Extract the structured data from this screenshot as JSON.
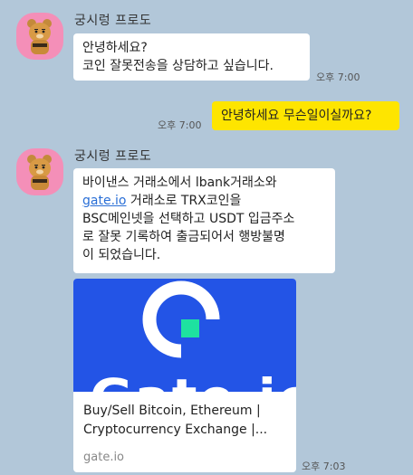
{
  "sender": {
    "name": "궁시렁 프로도"
  },
  "messages": [
    {
      "text": "안녕하세요?\n코인 잘못전송을 상담하고 싶습니다.",
      "time": "오후 7:00"
    },
    {
      "text": "안녕하세요 무슨일이실까요?",
      "time": "오후 7:00"
    },
    {
      "before": "바이낸스 거래소에서 lbank거래소와\n",
      "link": "gate.io",
      "after": " 거래소로 TRX코인을\nBSC메인넷을 선택하고 USDT 입금주소\n로 잘못 기록하여 출금되어서 행방불명\n이 되었습니다."
    },
    {
      "card_title": "Buy/Sell Bitcoin, Ethereum | Cryptocurrency Exchange |...",
      "card_domain": "gate.io",
      "card_brand": "Gate.io",
      "time": "오후 7:03"
    }
  ],
  "colors": {
    "background": "#b2c7d9",
    "my_bubble": "#fee500",
    "their_bubble": "#ffffff",
    "avatar_bg": "#f48fb8",
    "card_image_bg": "#2354e6",
    "card_logo_accent": "#1ee2a0"
  },
  "icons": {
    "avatar": "ryan-character-icon",
    "card_logo": "gate-io-logo-icon"
  }
}
